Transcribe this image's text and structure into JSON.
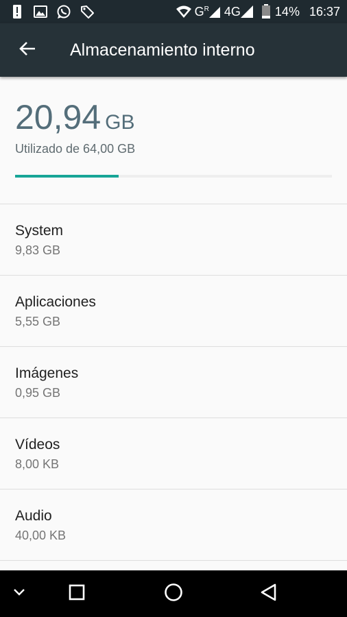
{
  "status_bar": {
    "network_label": "4G",
    "battery_percent": "14%",
    "time": "16:37",
    "icons": [
      "alert-icon",
      "image-icon",
      "whatsapp-icon",
      "tag-icon",
      "wifi-icon",
      "signal-icon",
      "battery-icon"
    ]
  },
  "app_bar": {
    "title": "Almacenamiento interno",
    "back_icon": "arrow-back-icon"
  },
  "summary": {
    "used_value": "20,94",
    "used_unit": "GB",
    "used_label": "Utilizado de 64,00 GB",
    "progress_fraction": 0.327,
    "progress_color": "#17a597"
  },
  "storage_items": [
    {
      "label": "System",
      "size": "9,83 GB"
    },
    {
      "label": "Aplicaciones",
      "size": "5,55 GB"
    },
    {
      "label": "Imágenes",
      "size": "0,95 GB"
    },
    {
      "label": "Vídeos",
      "size": "8,00 KB"
    },
    {
      "label": "Audio",
      "size": "40,00 KB"
    }
  ],
  "nav_bar": {
    "icons": [
      "chevron-down-icon",
      "recents-icon",
      "home-icon",
      "back-triangle-icon"
    ]
  }
}
